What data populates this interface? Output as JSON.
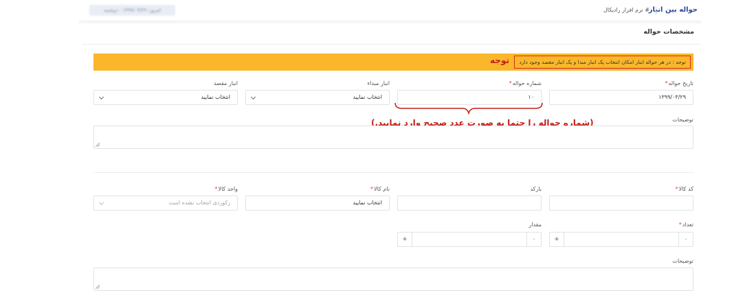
{
  "header": {
    "title": "حواله بین انبار",
    "subtitle": "# نرم افزار رادیکال",
    "blurred_chip": "امروز: ۱۳۹۹/۰۳/۲۹ - دوشنبه"
  },
  "section": {
    "title": "مشخصات حواله"
  },
  "notice": {
    "title": "توجه",
    "message": "توجه : در هر حواله انبار امکان انتخاب یک انبار مبدا و یک انبار مقصد وجود دارد",
    "background": "#fab72a",
    "border": "#d62b1e"
  },
  "form": {
    "date": {
      "label": "تاریخ حواله",
      "required": "*",
      "value": "۱۳۹۹/۰۳/۲۹"
    },
    "number": {
      "label": "شماره حواله",
      "required": "*",
      "value": "۱۰"
    },
    "source": {
      "label": "انبار مبداء",
      "value": "انتخاب نمایید"
    },
    "dest": {
      "label": "انبار مقصد",
      "value": "انتخاب نمایید"
    },
    "desc": {
      "label": "توضیحات",
      "value": ""
    }
  },
  "annotation": {
    "text": "(شماره حواله را حتما به صورت عدد صحیح وارد نمایید.)",
    "color": "#c21d17"
  },
  "item": {
    "code": {
      "label": "کد کالا",
      "required": "*",
      "value": ""
    },
    "barcode": {
      "label": "بارکد",
      "value": ""
    },
    "name": {
      "label": "نام کالا",
      "required": "*",
      "value": "انتخاب نمایید"
    },
    "unit": {
      "label": "واحد کالا",
      "required": "*",
      "placeholder": "رکوردی انتخاب نشده است"
    },
    "count": {
      "label": "تعداد",
      "required": "*",
      "value": "",
      "minus": "-",
      "plus": "+"
    },
    "amount": {
      "label": "مقدار",
      "value": "",
      "minus": "-",
      "plus": "+"
    },
    "desc": {
      "label": "توضیحات",
      "value": ""
    }
  }
}
